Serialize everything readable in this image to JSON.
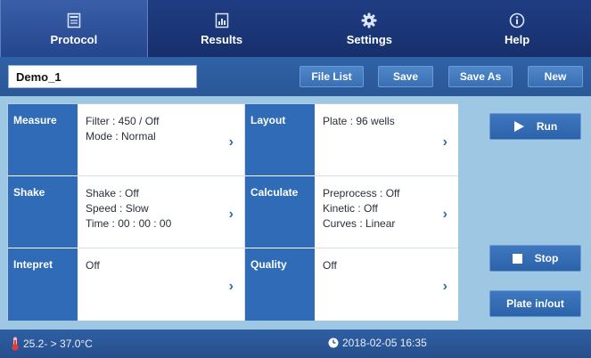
{
  "nav": {
    "tabs": [
      {
        "label": "Protocol",
        "icon": "protocol-icon",
        "active": true
      },
      {
        "label": "Results",
        "icon": "results-icon",
        "active": false
      },
      {
        "label": "Settings",
        "icon": "gear-icon",
        "active": false
      },
      {
        "label": "Help",
        "icon": "info-icon",
        "active": false
      }
    ]
  },
  "toolbar": {
    "filename": "Demo_1",
    "file_list_label": "File List",
    "save_label": "Save",
    "save_as_label": "Save As",
    "new_label": "New"
  },
  "grid": {
    "measure": {
      "label": "Measure",
      "line1": "Filter :  450 / Off",
      "line2": "Mode : Normal"
    },
    "layout": {
      "label": "Layout",
      "line1": "Plate :   96 wells"
    },
    "shake": {
      "label": "Shake",
      "line1": "Shake : Off",
      "line2": "Speed : Slow",
      "line3": "Time :  00 : 00 : 00"
    },
    "calculate": {
      "label": "Calculate",
      "line1": "Preprocess : Off",
      "line2": "Kinetic : Off",
      "line3": "Curves : Linear"
    },
    "intepret": {
      "label": "Intepret",
      "line1": "Off"
    },
    "quality": {
      "label": "Quality",
      "line1": "Off"
    }
  },
  "actions": {
    "run_label": "Run",
    "stop_label": "Stop",
    "plate_label": "Plate in/out"
  },
  "status": {
    "temperature": "25.2- > 37.0°C",
    "datetime": "2018-02-05 16:35"
  },
  "colors": {
    "nav_bg": "#1f3d83",
    "toolbar_bg": "#2f62a6",
    "label_bg": "#2f6bb6",
    "page_bg": "#9ec7e3"
  }
}
